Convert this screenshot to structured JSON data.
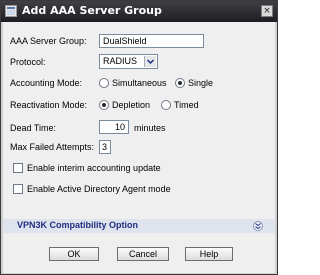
{
  "window": {
    "title": "Add AAA Server Group",
    "close_glyph": "×"
  },
  "form": {
    "server_group_label": "AAA Server Group:",
    "server_group_value": "DualShield",
    "protocol_label": "Protocol:",
    "protocol_value": "RADIUS",
    "accounting_mode_label": "Accounting Mode:",
    "accounting_options": [
      "Simultaneous",
      "Single"
    ],
    "accounting_selected": "Single",
    "reactivation_mode_label": "Reactivation Mode:",
    "reactivation_options": [
      "Depletion",
      "Timed"
    ],
    "reactivation_selected": "Depletion",
    "dead_time_label": "Dead Time:",
    "dead_time_value": "10",
    "dead_time_unit": "minutes",
    "max_failed_label": "Max Failed Attempts:",
    "max_failed_value": "3",
    "interim_label": "Enable interim accounting update",
    "interim_checked": false,
    "ad_agent_label": "Enable Active Directory Agent mode",
    "ad_agent_checked": false
  },
  "section": {
    "title": "VPN3K Compatibility Option",
    "icon": "double-chevron-down-icon"
  },
  "buttons": {
    "ok": "OK",
    "cancel": "Cancel",
    "help": "Help"
  },
  "colors": {
    "titlebar": "#2a2a30",
    "section_text": "#1e2f82",
    "section_bg": "#dfe3ee"
  }
}
